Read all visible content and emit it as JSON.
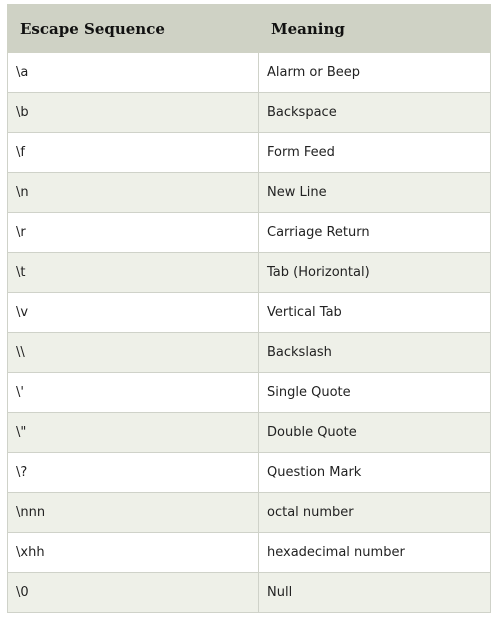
{
  "table": {
    "headers": [
      "Escape Sequence",
      "Meaning"
    ],
    "rows": [
      {
        "sequence": "\\a",
        "meaning": "Alarm or Beep"
      },
      {
        "sequence": "\\b",
        "meaning": "Backspace"
      },
      {
        "sequence": "\\f",
        "meaning": "Form Feed"
      },
      {
        "sequence": "\\n",
        "meaning": "New Line"
      },
      {
        "sequence": "\\r",
        "meaning": "Carriage Return"
      },
      {
        "sequence": "\\t",
        "meaning": "Tab (Horizontal)"
      },
      {
        "sequence": "\\v",
        "meaning": "Vertical Tab"
      },
      {
        "sequence": "\\\\",
        "meaning": "Backslash"
      },
      {
        "sequence": "\\'",
        "meaning": "Single Quote"
      },
      {
        "sequence": "\\\"",
        "meaning": "Double Quote"
      },
      {
        "sequence": "\\?",
        "meaning": "Question Mark"
      },
      {
        "sequence": "\\nnn",
        "meaning": "octal number"
      },
      {
        "sequence": "\\xhh",
        "meaning": "hexadecimal number"
      },
      {
        "sequence": "\\0",
        "meaning": "Null"
      }
    ]
  },
  "colors": {
    "header_background": "#cfd2c5",
    "row_alt_background": "#eef0e8",
    "row_background": "#ffffff",
    "border": "#cfd2c9"
  }
}
